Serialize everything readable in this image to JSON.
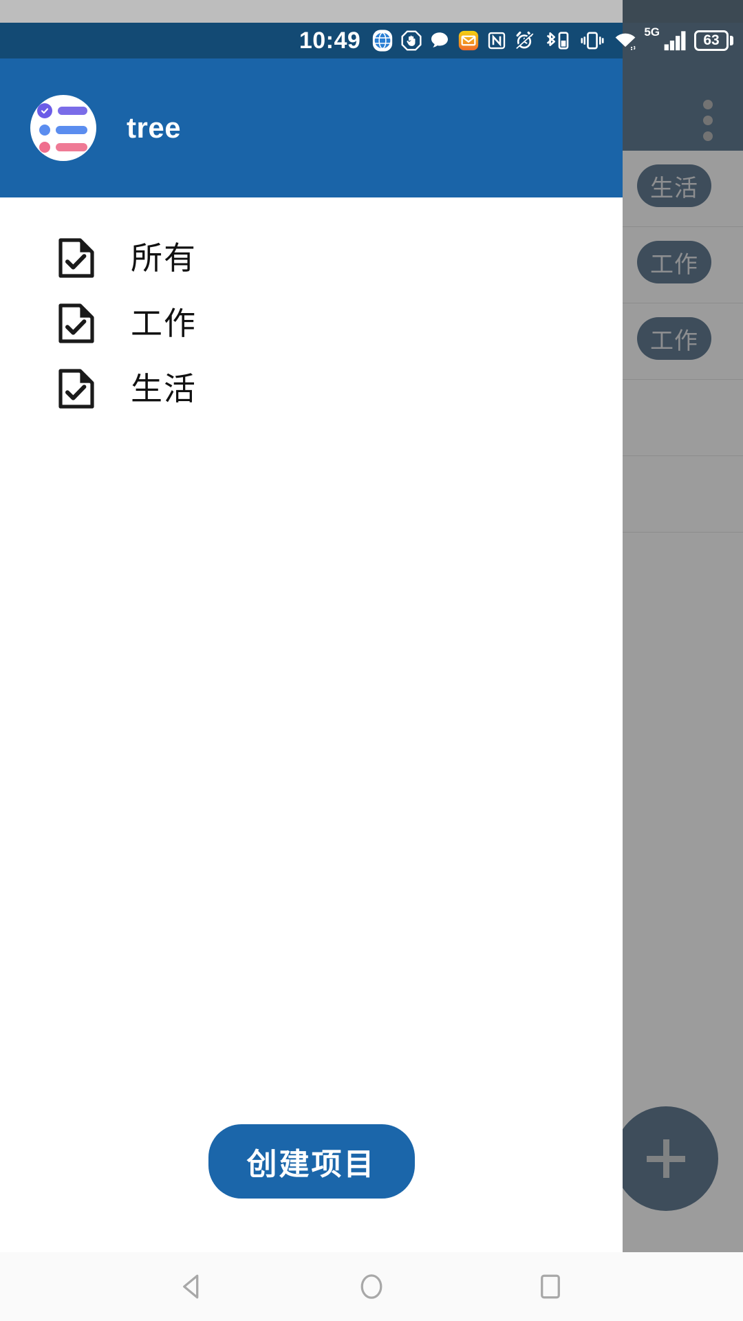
{
  "status_bar": {
    "time": "10:49",
    "battery_level": "63",
    "network_label": "5G",
    "icons": [
      "globe-icon",
      "stop-hand-icon",
      "chat-bubble-icon",
      "mail-icon",
      "nfc-icon",
      "alarm-clock-icon",
      "bluetooth-device-icon",
      "vibrate-icon",
      "wifi-icon",
      "signal-bars-icon",
      "battery-icon"
    ],
    "colors": {
      "background": "#134a74",
      "gray_strip": "#bdbdbd"
    }
  },
  "drawer": {
    "app_title": "tree",
    "header_color": "#1a64a8",
    "logo_name": "tree-checklist-logo",
    "items": [
      {
        "label": "所有",
        "icon": "document-check-icon"
      },
      {
        "label": "工作",
        "icon": "document-check-icon"
      },
      {
        "label": "生活",
        "icon": "document-check-icon"
      }
    ],
    "create_button_label": "创建项目",
    "create_button_color": "#1b66aa"
  },
  "background_app": {
    "appbar_color": "#123a5c",
    "overflow_menu_name": "overflow-menu-icon",
    "fab_label": "+",
    "fab_color": "#143a5c",
    "rows": [
      {
        "chip": "生活"
      },
      {
        "chip": "工作"
      },
      {
        "chip": "工作"
      },
      {
        "chip": ""
      },
      {
        "chip": ""
      }
    ],
    "scrim_color": "rgba(90,90,90,0.60)"
  },
  "nav_bar": {
    "back_label": "back-icon",
    "home_label": "home-icon",
    "recents_label": "recents-icon"
  }
}
